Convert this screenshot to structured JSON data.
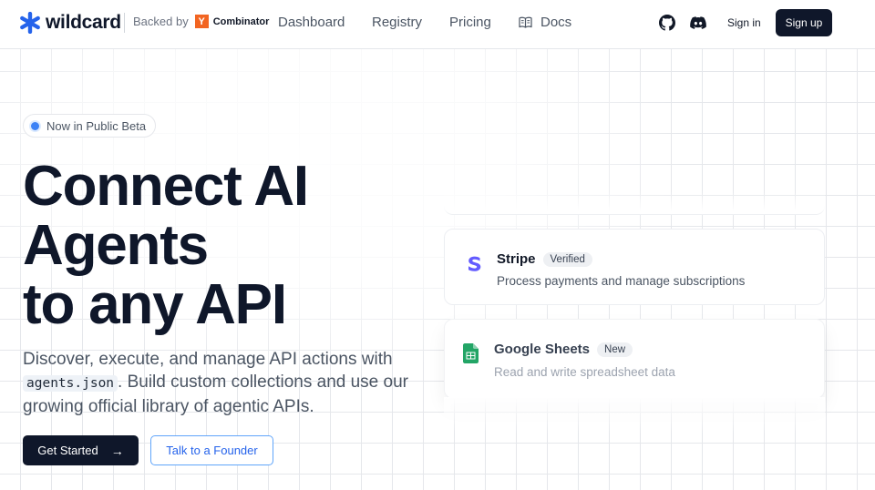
{
  "brand": {
    "name": "wildcard",
    "accent": "#2563eb"
  },
  "backed": {
    "label": "Backed by",
    "yc_letter": "Y",
    "yc_name": "Combinator"
  },
  "nav": {
    "dashboard": "Dashboard",
    "registry": "Registry",
    "pricing": "Pricing",
    "docs": "Docs"
  },
  "auth": {
    "sign_in": "Sign in",
    "sign_up": "Sign up"
  },
  "hero": {
    "badge": "Now in Public Beta",
    "headline_lines": [
      "Connect AI",
      "Agents",
      "to any API"
    ],
    "sub_before": "Discover, execute, and manage API actions with",
    "sub_code": "agents.json",
    "sub_after": ". Build custom collections and use our growing official library of agentic APIs.",
    "cta_primary": "Get Started",
    "cta_secondary": "Talk to a Founder"
  },
  "cards": [
    {
      "title": "Stripe",
      "tag": "Verified",
      "desc": "Process payments and manage subscriptions",
      "icon": "stripe-icon",
      "color": "#635bff"
    },
    {
      "title": "Google Sheets",
      "tag": "New",
      "desc": "Read and write spreadsheet data",
      "icon": "google-sheets-icon",
      "color": "#23a566"
    }
  ]
}
